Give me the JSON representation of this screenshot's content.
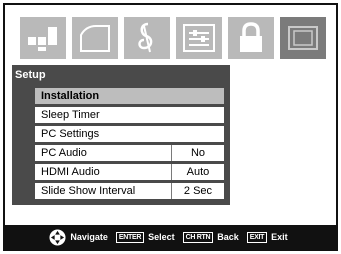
{
  "icons": [
    "picture-icon",
    "sound-icon",
    "music-icon",
    "preferences-icon",
    "lock-icon",
    "setup-icon"
  ],
  "panel": {
    "title": "Setup"
  },
  "menu": {
    "items": [
      {
        "label": "Installation",
        "value": null
      },
      {
        "label": "Sleep Timer",
        "value": null
      },
      {
        "label": "PC Settings",
        "value": null
      },
      {
        "label": "PC Audio",
        "value": "No"
      },
      {
        "label": "HDMI Audio",
        "value": "Auto"
      },
      {
        "label": "Slide Show Interval",
        "value": "2 Sec"
      }
    ],
    "selected_index": 0
  },
  "footer": {
    "navigate": "Navigate",
    "enter_key": "ENTER",
    "select": "Select",
    "chrtn_key": "CH RTN",
    "back": "Back",
    "exit_key": "EXIT",
    "exit": "Exit"
  },
  "colors": {
    "panel_bg": "#4a4a4a",
    "selected_row": "#bdbdbd",
    "icon_tab": "#b9b9b9",
    "active_icon_tab": "#7b7b7b",
    "footer_bg": "#111111"
  }
}
